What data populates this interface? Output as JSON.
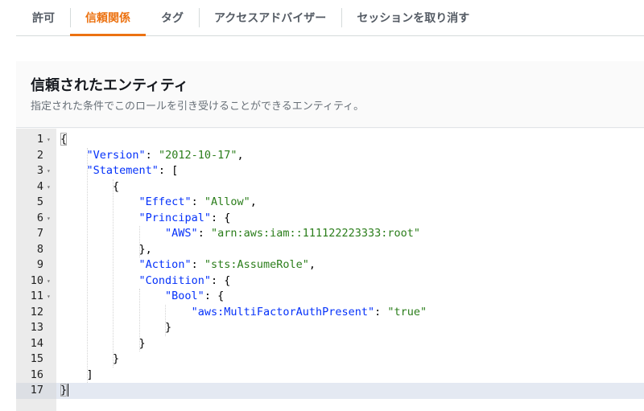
{
  "tabs": [
    {
      "label": "許可",
      "active": false
    },
    {
      "label": "信頼関係",
      "active": true
    },
    {
      "label": "タグ",
      "active": false
    },
    {
      "label": "アクセスアドバイザー",
      "active": false
    },
    {
      "label": "セッションを取り消す",
      "active": false
    }
  ],
  "panel": {
    "title": "信頼されたエンティティ",
    "description": "指定された条件でこのロールを引き受けることができるエンティティ。"
  },
  "editor": {
    "active_line": 17,
    "foldable_lines": [
      1,
      3,
      4,
      6,
      10,
      11
    ],
    "lines": [
      {
        "n": "1",
        "t": "{"
      },
      {
        "n": "2",
        "t": "    \"Version\": \"2012-10-17\","
      },
      {
        "n": "3",
        "t": "    \"Statement\": ["
      },
      {
        "n": "4",
        "t": "        {"
      },
      {
        "n": "5",
        "t": "            \"Effect\": \"Allow\","
      },
      {
        "n": "6",
        "t": "            \"Principal\": {"
      },
      {
        "n": "7",
        "t": "                \"AWS\": \"arn:aws:iam::111122223333:root\""
      },
      {
        "n": "8",
        "t": "            },"
      },
      {
        "n": "9",
        "t": "            \"Action\": \"sts:AssumeRole\","
      },
      {
        "n": "10",
        "t": "            \"Condition\": {"
      },
      {
        "n": "11",
        "t": "                \"Bool\": {"
      },
      {
        "n": "12",
        "t": "                    \"aws:MultiFactorAuthPresent\": \"true\""
      },
      {
        "n": "13",
        "t": "                }"
      },
      {
        "n": "14",
        "t": "            }"
      },
      {
        "n": "15",
        "t": "        }"
      },
      {
        "n": "16",
        "t": "    ]"
      },
      {
        "n": "17",
        "t": "}"
      }
    ]
  },
  "colors": {
    "accent": "#ec7211",
    "json_key": "#0431fa",
    "json_string": "#2a7d1a"
  }
}
